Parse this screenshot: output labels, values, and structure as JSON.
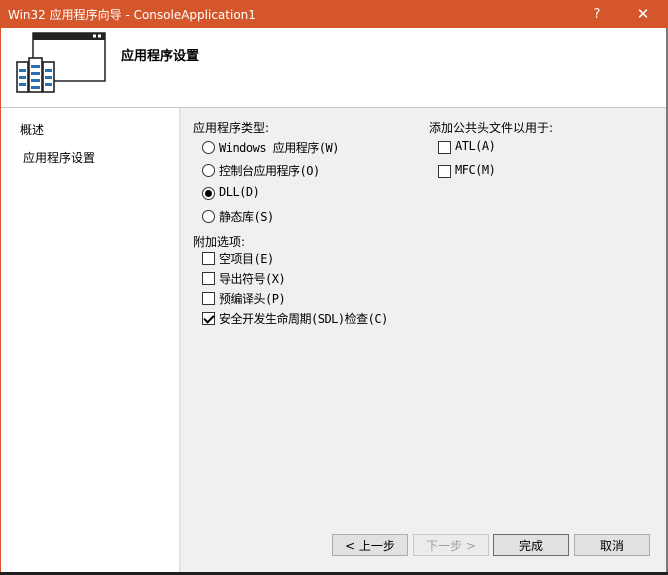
{
  "window": {
    "title": "Win32 应用程序向导 - ConsoleApplication1",
    "help_label": "?",
    "close_label": "✕"
  },
  "header": {
    "title": "应用程序设置",
    "icon": "wizard-icon"
  },
  "sidebar": {
    "items": [
      {
        "label": "概述"
      },
      {
        "label": "应用程序设置"
      }
    ]
  },
  "app_type": {
    "heading": "应用程序类型:",
    "options": [
      {
        "label": "Windows 应用程序(W)",
        "checked": false
      },
      {
        "label": "控制台应用程序(O)",
        "checked": false
      },
      {
        "label": "DLL(D)",
        "checked": true
      },
      {
        "label": "静态库(S)",
        "checked": false
      }
    ]
  },
  "extra": {
    "heading": "附加选项:",
    "options": [
      {
        "label": "空项目(E)",
        "checked": false
      },
      {
        "label": "导出符号(X)",
        "checked": false
      },
      {
        "label": "预编译头(P)",
        "checked": false
      },
      {
        "label": "安全开发生命周期(SDL)检查(C)",
        "checked": true
      }
    ]
  },
  "headers": {
    "heading": "添加公共头文件以用于:",
    "options": [
      {
        "label": "ATL(A)",
        "checked": false
      },
      {
        "label": "MFC(M)",
        "checked": false
      }
    ]
  },
  "buttons": {
    "prev": "< 上一步",
    "next": "下一步 >",
    "finish": "完成",
    "cancel": "取消"
  }
}
